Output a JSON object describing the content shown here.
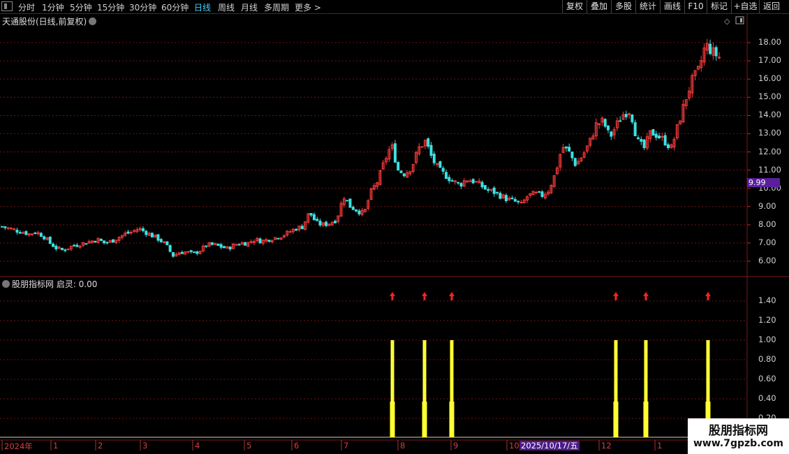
{
  "toolbar": {
    "tabs": [
      "分时",
      "1分钟",
      "5分钟",
      "15分钟",
      "30分钟",
      "60分钟",
      "日线",
      "周线",
      "月线",
      "多周期",
      "更多 >"
    ],
    "active_tab": "日线",
    "right_buttons": [
      "复权",
      "叠加",
      "多股",
      "统计",
      "画线",
      "F10",
      "标记",
      "+自选",
      "返回"
    ]
  },
  "main_chart": {
    "title": "天通股份(日线,前复权)",
    "price_tag": "9.99",
    "y_ticks": [
      "18.00",
      "17.00",
      "16.00",
      "15.00",
      "14.00",
      "13.00",
      "12.00",
      "11.00",
      "10.00",
      "9.00",
      "8.00",
      "7.00",
      "6.00"
    ]
  },
  "indicator": {
    "title": "股朋指标网  启灵: 0.00",
    "y_ticks": [
      "1.40",
      "1.20",
      "1.00",
      "0.80",
      "0.60",
      "0.40",
      "0.20"
    ]
  },
  "time_axis": {
    "labels": [
      "2024年",
      "1",
      "2",
      "3",
      "4",
      "5",
      "6",
      "7",
      "8",
      "9",
      "10",
      "12",
      "1"
    ],
    "cursor_date": "2025/10/17/五"
  },
  "watermark": {
    "line1": "股朋指标网",
    "line2": "www.7gpzb.com"
  },
  "colors": {
    "up": "#ff3c3c",
    "down": "#3fe0e0",
    "signal": "#ffff33",
    "arrow": "#ff2020",
    "grid": "#6e1414",
    "accent": "#3fd0ff",
    "purple": "#5a1f9e"
  },
  "chart_data": [
    {
      "type": "candlestick",
      "title": "天通股份(日线,前复权)",
      "ylim": [
        5.5,
        19.2
      ],
      "y_ticks": [
        6,
        7,
        8,
        9,
        10,
        11,
        12,
        13,
        14,
        15,
        16,
        17,
        18
      ],
      "close_series_approx": [
        7.9,
        7.8,
        7.7,
        7.6,
        7.5,
        7.6,
        7.4,
        7.0,
        6.7,
        6.6,
        6.8,
        6.9,
        7.0,
        7.1,
        7.2,
        7.0,
        7.1,
        7.3,
        7.5,
        7.6,
        7.8,
        7.6,
        7.4,
        7.2,
        6.9,
        6.3,
        6.5,
        6.5,
        6.4,
        6.6,
        6.9,
        6.9,
        6.8,
        6.7,
        6.9,
        7.0,
        7.0,
        7.2,
        7.1,
        7.2,
        7.3,
        7.4,
        7.6,
        7.8,
        7.9,
        8.7,
        8.1,
        8.0,
        8.1,
        8.3,
        9.6,
        9.0,
        8.8,
        8.6,
        9.8,
        10.4,
        11.5,
        12.4,
        11.0,
        10.8,
        11.2,
        12.2,
        12.6,
        11.6,
        11.0,
        10.7,
        10.4,
        10.2,
        10.5,
        10.4,
        10.2,
        9.9,
        9.8,
        9.6,
        9.4,
        9.3,
        9.1,
        9.6,
        9.7,
        9.6,
        9.9,
        10.8,
        12.3,
        12.0,
        11.3,
        11.8,
        12.5,
        13.5,
        13.7,
        12.8,
        13.5,
        14.1,
        14.3,
        12.6,
        12.2,
        13.1,
        12.9,
        12.6,
        12.2,
        13.5,
        14.8,
        15.9,
        16.5,
        17.9,
        17.5,
        17.2
      ],
      "last_price_label": 9.99
    },
    {
      "type": "bar",
      "title": "股朋指标网  启灵: 0.00",
      "ylim": [
        0,
        1.6
      ],
      "y_ticks": [
        0.2,
        0.4,
        0.6,
        0.8,
        1.0,
        1.2,
        1.4
      ],
      "signal_value": 1.0,
      "signal_count": 6,
      "current_value": 0.0
    }
  ]
}
